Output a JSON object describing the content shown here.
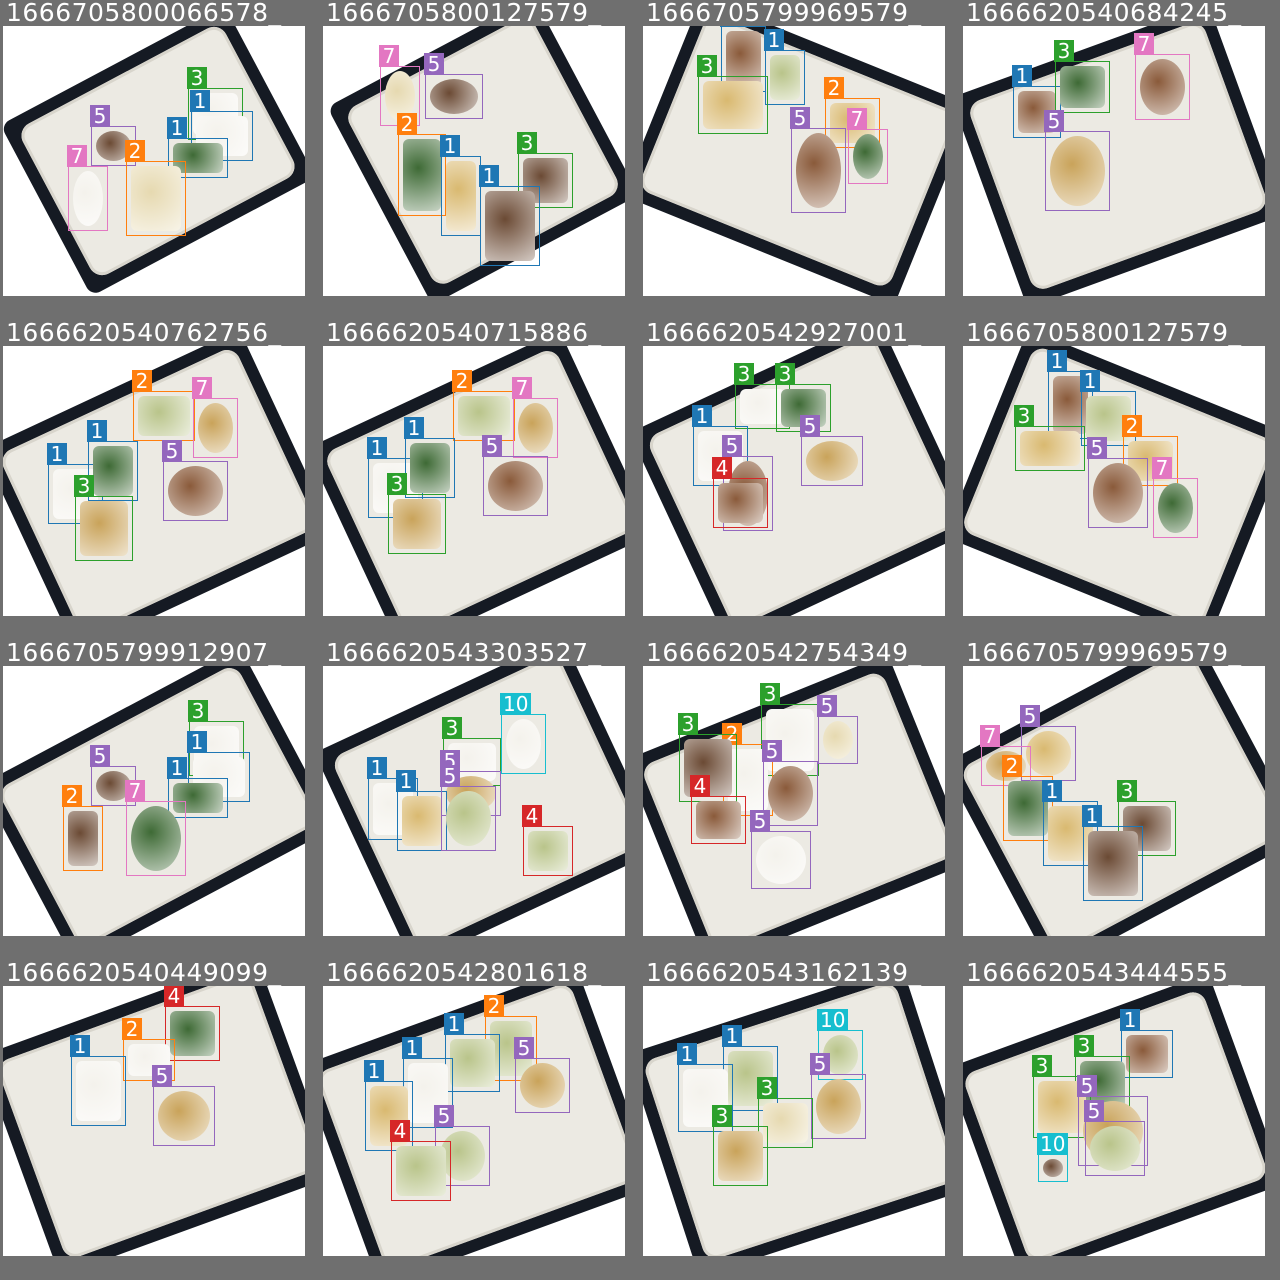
{
  "class_colors": {
    "1": "#1f77b4",
    "2": "#ff7f0e",
    "3": "#2ca02c",
    "4": "#d62728",
    "5": "#9467bd",
    "7": "#e377c2",
    "10": "#17becf"
  },
  "tiles": [
    {
      "title": "1666705800066578_",
      "detections": [
        {
          "cls": "3",
          "label": "3"
        },
        {
          "cls": "5",
          "label": "5"
        },
        {
          "cls": "1",
          "label": "1"
        },
        {
          "cls": "1",
          "label": "1"
        },
        {
          "cls": "7",
          "label": "7"
        },
        {
          "cls": "2",
          "label": "2"
        }
      ]
    },
    {
      "title": "1666705800127579_",
      "detections": [
        {
          "cls": "7",
          "label": "7"
        },
        {
          "cls": "5",
          "label": "5"
        },
        {
          "cls": "2",
          "label": "2"
        },
        {
          "cls": "3",
          "label": "3"
        },
        {
          "cls": "1",
          "label": "1"
        },
        {
          "cls": "1",
          "label": "1"
        }
      ]
    },
    {
      "title": "1666705799969579_",
      "detections": [
        {
          "cls": "1",
          "label": "1"
        },
        {
          "cls": "1",
          "label": "1"
        },
        {
          "cls": "3",
          "label": "3"
        },
        {
          "cls": "2",
          "label": "2"
        },
        {
          "cls": "5",
          "label": "5"
        },
        {
          "cls": "7",
          "label": "7"
        }
      ]
    },
    {
      "title": "1666620540684245_",
      "detections": [
        {
          "cls": "1",
          "label": "1"
        },
        {
          "cls": "3",
          "label": "3"
        },
        {
          "cls": "7",
          "label": "7"
        },
        {
          "cls": "5",
          "label": "5"
        }
      ]
    },
    {
      "title": "1666620540762756_",
      "detections": [
        {
          "cls": "2",
          "label": "2"
        },
        {
          "cls": "7",
          "label": "7"
        },
        {
          "cls": "1",
          "label": "1"
        },
        {
          "cls": "1",
          "label": "1"
        },
        {
          "cls": "5",
          "label": "5"
        },
        {
          "cls": "3",
          "label": "3"
        }
      ]
    },
    {
      "title": "1666620540715886_",
      "detections": [
        {
          "cls": "2",
          "label": "2"
        },
        {
          "cls": "7",
          "label": "7"
        },
        {
          "cls": "1",
          "label": "1"
        },
        {
          "cls": "1",
          "label": "1"
        },
        {
          "cls": "5",
          "label": "5"
        },
        {
          "cls": "3",
          "label": "3"
        }
      ]
    },
    {
      "title": "1666620542927001_",
      "detections": [
        {
          "cls": "3",
          "label": "3"
        },
        {
          "cls": "3",
          "label": "3"
        },
        {
          "cls": "1",
          "label": "1"
        },
        {
          "cls": "5",
          "label": "5"
        },
        {
          "cls": "5",
          "label": "5"
        },
        {
          "cls": "4",
          "label": "4"
        }
      ]
    },
    {
      "title": "1666705800127579_",
      "detections": [
        {
          "cls": "1",
          "label": "1"
        },
        {
          "cls": "1",
          "label": "1"
        },
        {
          "cls": "3",
          "label": "3"
        },
        {
          "cls": "2",
          "label": "2"
        },
        {
          "cls": "5",
          "label": "5"
        },
        {
          "cls": "7",
          "label": "7"
        }
      ]
    },
    {
      "title": "1666705799912907_",
      "detections": [
        {
          "cls": "3",
          "label": "3"
        },
        {
          "cls": "5",
          "label": "5"
        },
        {
          "cls": "1",
          "label": "1"
        },
        {
          "cls": "1",
          "label": "1"
        },
        {
          "cls": "2",
          "label": "2"
        },
        {
          "cls": "7",
          "label": "7"
        }
      ]
    },
    {
      "title": "1666620543303527_",
      "detections": [
        {
          "cls": "3",
          "label": "3"
        },
        {
          "cls": "10",
          "label": "10"
        },
        {
          "cls": "1",
          "label": "1"
        },
        {
          "cls": "5",
          "label": "5"
        },
        {
          "cls": "1",
          "label": "1"
        },
        {
          "cls": "5",
          "label": "5"
        },
        {
          "cls": "4",
          "label": "4"
        }
      ]
    },
    {
      "title": "1666620542754349_",
      "detections": [
        {
          "cls": "3",
          "label": "3"
        },
        {
          "cls": "2",
          "label": "2"
        },
        {
          "cls": "5",
          "label": "5"
        },
        {
          "cls": "3",
          "label": "3"
        },
        {
          "cls": "5",
          "label": "5"
        },
        {
          "cls": "4",
          "label": "4"
        },
        {
          "cls": "5",
          "label": "5"
        }
      ]
    },
    {
      "title": "1666705799969579_",
      "detections": [
        {
          "cls": "5",
          "label": "5"
        },
        {
          "cls": "7",
          "label": "7"
        },
        {
          "cls": "2",
          "label": "2"
        },
        {
          "cls": "3",
          "label": "3"
        },
        {
          "cls": "1",
          "label": "1"
        },
        {
          "cls": "1",
          "label": "1"
        }
      ]
    },
    {
      "title": "1666620540449099_",
      "detections": [
        {
          "cls": "4",
          "label": "4"
        },
        {
          "cls": "2",
          "label": "2"
        },
        {
          "cls": "1",
          "label": "1"
        },
        {
          "cls": "5",
          "label": "5"
        }
      ]
    },
    {
      "title": "1666620542801618_",
      "detections": [
        {
          "cls": "2",
          "label": "2"
        },
        {
          "cls": "1",
          "label": "1"
        },
        {
          "cls": "1",
          "label": "1"
        },
        {
          "cls": "5",
          "label": "5"
        },
        {
          "cls": "1",
          "label": "1"
        },
        {
          "cls": "5",
          "label": "5"
        },
        {
          "cls": "4",
          "label": "4"
        }
      ]
    },
    {
      "title": "1666620543162139_",
      "detections": [
        {
          "cls": "10",
          "label": "10"
        },
        {
          "cls": "1",
          "label": "1"
        },
        {
          "cls": "1",
          "label": "1"
        },
        {
          "cls": "5",
          "label": "5"
        },
        {
          "cls": "3",
          "label": "3"
        },
        {
          "cls": "3",
          "label": "3"
        }
      ]
    },
    {
      "title": "1666620543444555_",
      "detections": [
        {
          "cls": "1",
          "label": "1"
        },
        {
          "cls": "3",
          "label": "3"
        },
        {
          "cls": "3",
          "label": "3"
        },
        {
          "cls": "5",
          "label": "5"
        },
        {
          "cls": "10",
          "label": "10"
        },
        {
          "cls": "5",
          "label": "5"
        }
      ]
    }
  ]
}
